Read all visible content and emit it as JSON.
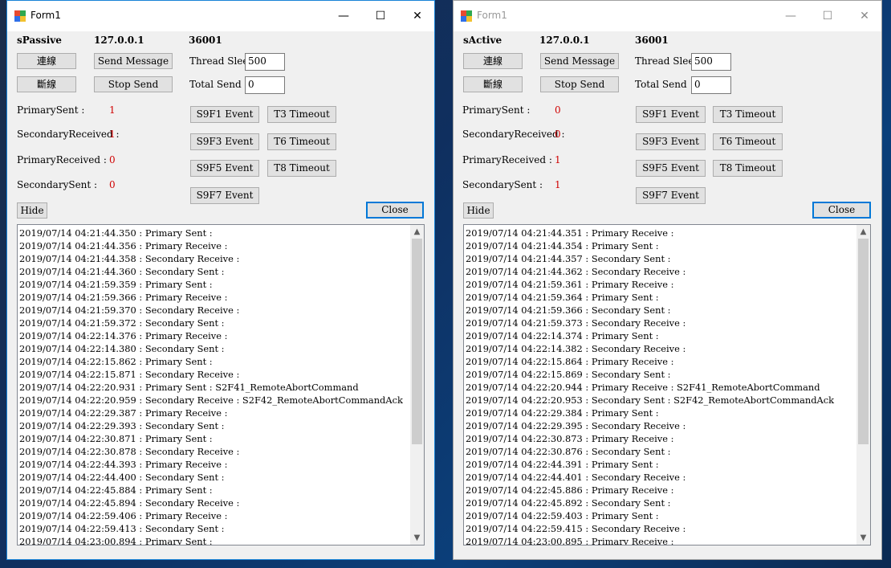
{
  "left": {
    "title": "Form1",
    "mode": "sPassive",
    "ip": "127.0.0.1",
    "port": "36001",
    "connect": "連線",
    "disconnect": "斷線",
    "send_message": "Send Message",
    "stop_send": "Stop Send",
    "thread_sleep_label": "Thread Sleep",
    "thread_sleep_value": "500",
    "total_send_label": "Total Send",
    "total_send_value": "0",
    "stats": [
      {
        "label": "PrimarySent :",
        "value": "1"
      },
      {
        "label": "SecondaryReceived :",
        "value": "1"
      },
      {
        "label": "PrimaryReceived :",
        "value": "0"
      },
      {
        "label": "SecondarySent :",
        "value": "0"
      }
    ],
    "events": [
      "S9F1 Event",
      "T3 Timeout",
      "S9F3 Event",
      "T6 Timeout",
      "S9F5 Event",
      "T8 Timeout",
      "S9F7 Event"
    ],
    "hide": "Hide",
    "close": "Close",
    "log": [
      "2019/07/14 04:21:44.350 : Primary Sent :",
      "2019/07/14 04:21:44.356 : Primary Receive :",
      "2019/07/14 04:21:44.358 : Secondary Receive :",
      "2019/07/14 04:21:44.360 : Secondary Sent :",
      "2019/07/14 04:21:59.359 : Primary Sent :",
      "2019/07/14 04:21:59.366 : Primary Receive :",
      "2019/07/14 04:21:59.370 : Secondary Receive :",
      "2019/07/14 04:21:59.372 : Secondary Sent :",
      "2019/07/14 04:22:14.376 : Primary Receive :",
      "2019/07/14 04:22:14.380 : Secondary Sent :",
      "2019/07/14 04:22:15.862 : Primary Sent :",
      "2019/07/14 04:22:15.871 : Secondary Receive :",
      "2019/07/14 04:22:20.931 : Primary Sent : S2F41_RemoteAbortCommand",
      "2019/07/14 04:22:20.959 : Secondary Receive : S2F42_RemoteAbortCommandAck",
      "2019/07/14 04:22:29.387 : Primary Receive :",
      "2019/07/14 04:22:29.393 : Secondary Sent :",
      "2019/07/14 04:22:30.871 : Primary Sent :",
      "2019/07/14 04:22:30.878 : Secondary Receive :",
      "2019/07/14 04:22:44.393 : Primary Receive :",
      "2019/07/14 04:22:44.400 : Secondary Sent :",
      "2019/07/14 04:22:45.884 : Primary Sent :",
      "2019/07/14 04:22:45.894 : Secondary Receive :",
      "2019/07/14 04:22:59.406 : Primary Receive :",
      "2019/07/14 04:22:59.413 : Secondary Sent :",
      "2019/07/14 04:23:00.894 : Primary Sent :"
    ]
  },
  "right": {
    "title": "Form1",
    "mode": "sActive",
    "ip": "127.0.0.1",
    "port": "36001",
    "connect": "連線",
    "disconnect": "斷線",
    "send_message": "Send Message",
    "stop_send": "Stop Send",
    "thread_sleep_label": "Thread Sleep",
    "thread_sleep_value": "500",
    "total_send_label": "Total Send",
    "total_send_value": "0",
    "stats": [
      {
        "label": "PrimarySent :",
        "value": "0"
      },
      {
        "label": "SecondaryReceived :",
        "value": "0"
      },
      {
        "label": "PrimaryReceived :",
        "value": "1"
      },
      {
        "label": "SecondarySent :",
        "value": "1"
      }
    ],
    "events": [
      "S9F1 Event",
      "T3 Timeout",
      "S9F3 Event",
      "T6 Timeout",
      "S9F5 Event",
      "T8 Timeout",
      "S9F7 Event"
    ],
    "hide": "Hide",
    "close": "Close",
    "log": [
      "2019/07/14 04:21:44.351 : Primary Receive :",
      "2019/07/14 04:21:44.354 : Primary Sent :",
      "2019/07/14 04:21:44.357 : Secondary Sent :",
      "2019/07/14 04:21:44.362 : Secondary Receive :",
      "2019/07/14 04:21:59.361 : Primary Receive :",
      "2019/07/14 04:21:59.364 : Primary Sent :",
      "2019/07/14 04:21:59.366 : Secondary Sent :",
      "2019/07/14 04:21:59.373 : Secondary Receive :",
      "2019/07/14 04:22:14.374 : Primary Sent :",
      "2019/07/14 04:22:14.382 : Secondary Receive :",
      "2019/07/14 04:22:15.864 : Primary Receive :",
      "2019/07/14 04:22:15.869 : Secondary Sent :",
      "2019/07/14 04:22:20.944 : Primary Receive : S2F41_RemoteAbortCommand",
      "2019/07/14 04:22:20.953 : Secondary Sent : S2F42_RemoteAbortCommandAck",
      "2019/07/14 04:22:29.384 : Primary Sent :",
      "2019/07/14 04:22:29.395 : Secondary Receive :",
      "2019/07/14 04:22:30.873 : Primary Receive :",
      "2019/07/14 04:22:30.876 : Secondary Sent :",
      "2019/07/14 04:22:44.391 : Primary Sent :",
      "2019/07/14 04:22:44.401 : Secondary Receive :",
      "2019/07/14 04:22:45.886 : Primary Receive :",
      "2019/07/14 04:22:45.892 : Secondary Sent :",
      "2019/07/14 04:22:59.403 : Primary Sent :",
      "2019/07/14 04:22:59.415 : Secondary Receive :",
      "2019/07/14 04:23:00.895 : Primary Receive :"
    ]
  },
  "colors": {
    "accent": "#0078d7",
    "stat_value": "#d00000",
    "window_bg": "#f0f0f0"
  }
}
